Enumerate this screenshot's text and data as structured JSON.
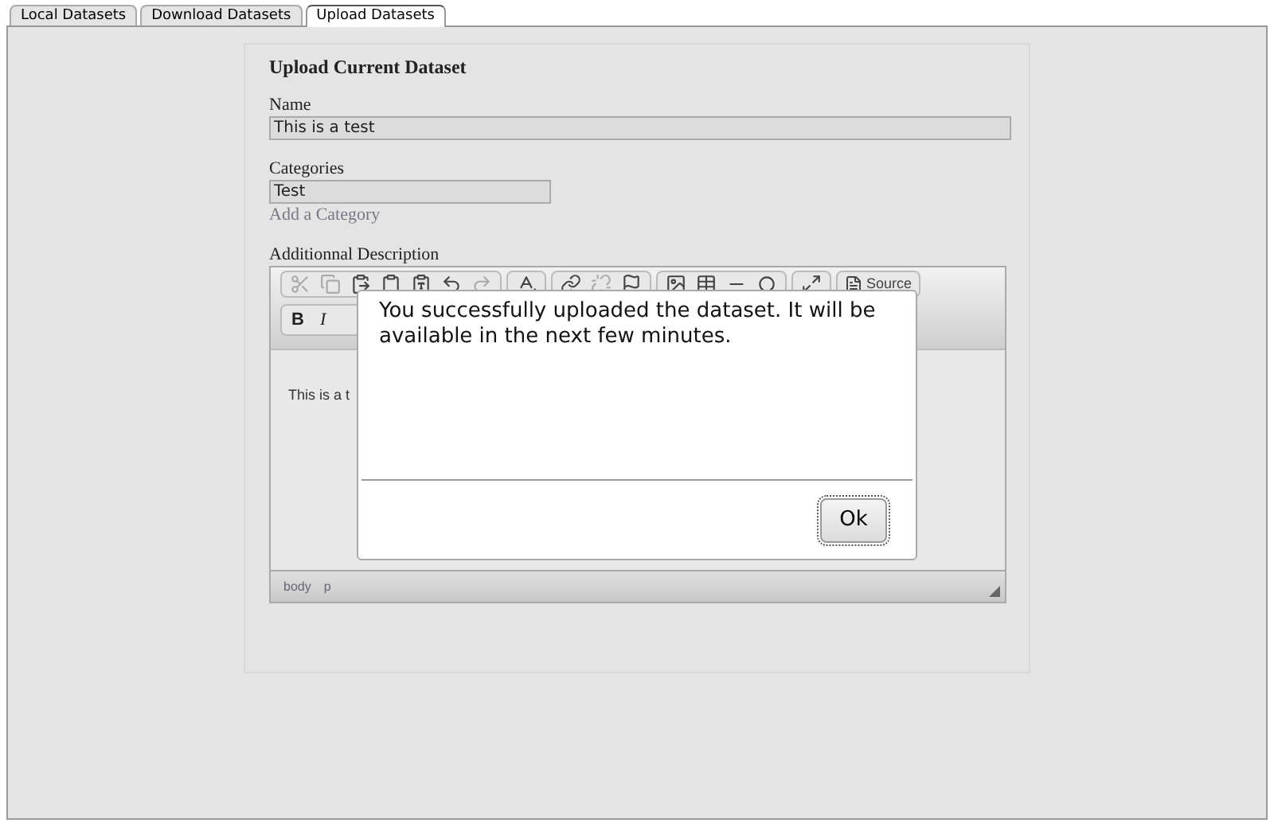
{
  "tabs": [
    {
      "label": "Local Datasets",
      "selected": false
    },
    {
      "label": "Download Datasets",
      "selected": false
    },
    {
      "label": "Upload Datasets",
      "selected": true
    }
  ],
  "form": {
    "title": "Upload Current Dataset",
    "name_label": "Name",
    "name_value": "This is a test",
    "categories_label": "Categories",
    "categories_value": "Test",
    "add_category_link": "Add a Category",
    "description_label": "Additionnal Description"
  },
  "editor": {
    "source_button": "Source",
    "bold_button": "B",
    "italic_button": "I",
    "content": "This is a t",
    "path": [
      "body",
      "p"
    ]
  },
  "dialog": {
    "message": "You successfully uploaded the dataset. It will be available in the next few minutes.",
    "ok_button": "Ok"
  }
}
